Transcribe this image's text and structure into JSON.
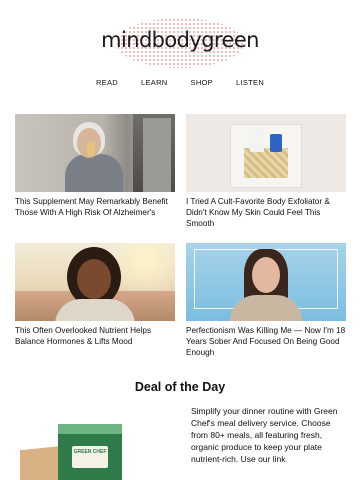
{
  "brand": {
    "logo_text": "mindbodygreen"
  },
  "nav": {
    "items": [
      {
        "label": "READ"
      },
      {
        "label": "LEARN"
      },
      {
        "label": "SHOP"
      },
      {
        "label": "LISTEN"
      }
    ]
  },
  "articles": [
    {
      "title": "This Supplement May Remarkably Benefit Those With A High Risk Of Alzheimer's"
    },
    {
      "title": "I Tried A Cult-Favorite Body Exfoliator & Didn't Know My Skin Could Feel This Smooth"
    },
    {
      "title": "This Often Overlooked Nutrient Helps Balance Hormones & Lifts Mood"
    },
    {
      "title": "Perfectionism Was Killing Me — Now I'm 18 Years Sober And Focused On Being Good Enough"
    }
  ],
  "deal": {
    "heading": "Deal of the Day",
    "text": "Simplify your dinner routine with Green Chef's meal delivery service. Choose from 80+ meals, all featuring fresh, organic produce to keep your plate nutrient-rich. Use our link",
    "product_label": "GREEN CHEF"
  },
  "colors": {
    "logo_dots": "#f2a7a7",
    "text": "#111111",
    "background": "#ffffff"
  }
}
